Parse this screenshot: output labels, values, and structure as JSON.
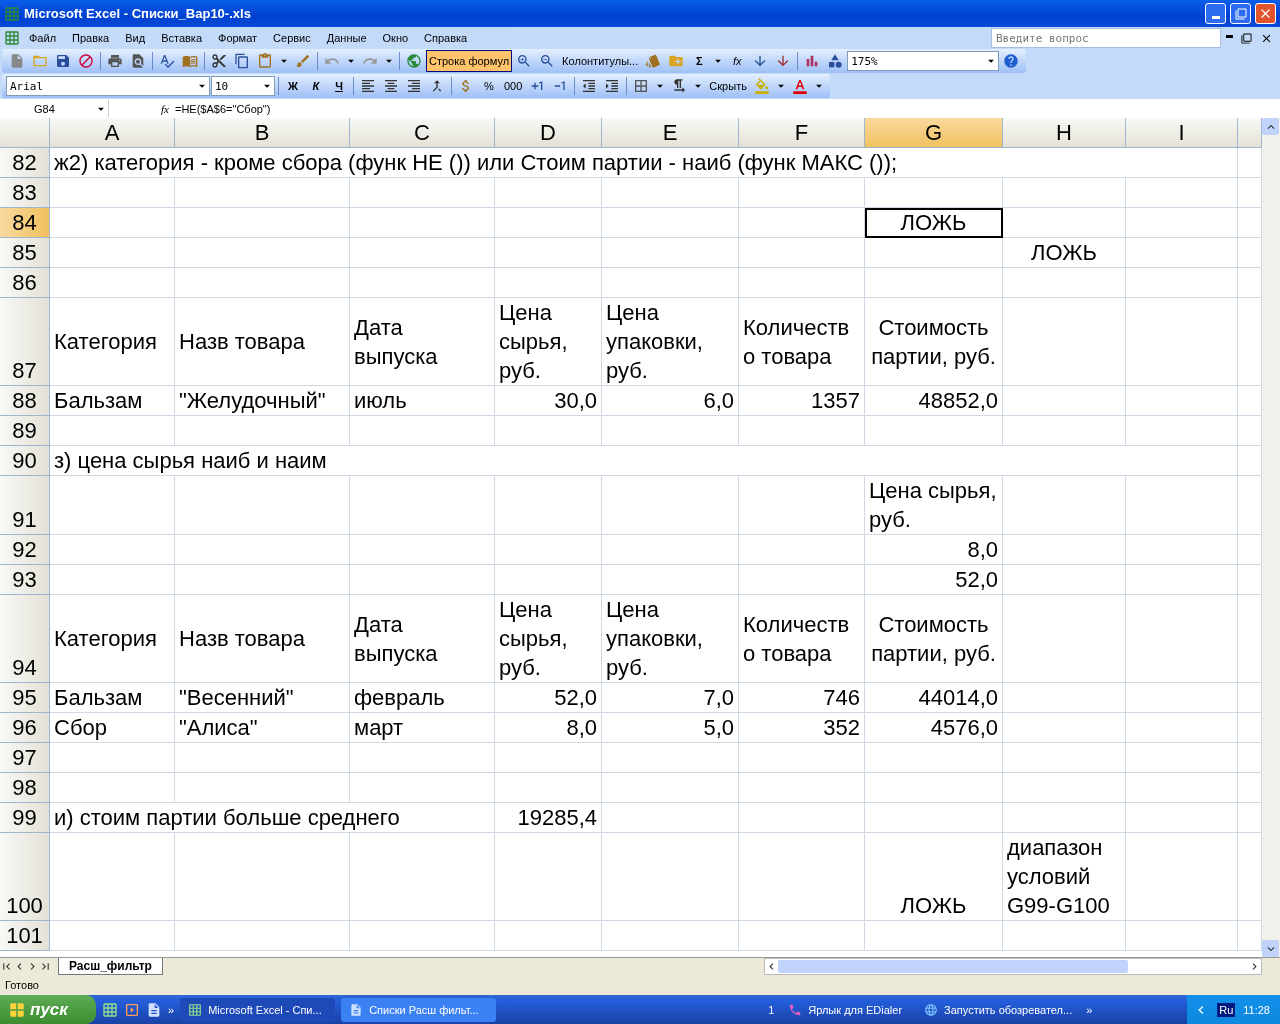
{
  "window": {
    "title": "Microsoft Excel - Списки_Вар10-.xls"
  },
  "menu": [
    {
      "label": "Файл"
    },
    {
      "label": "Правка"
    },
    {
      "label": "Вид"
    },
    {
      "label": "Вставка"
    },
    {
      "label": "Формат"
    },
    {
      "label": "Сервис"
    },
    {
      "label": "Данные"
    },
    {
      "label": "Окно"
    },
    {
      "label": "Справка"
    }
  ],
  "help_search": {
    "placeholder": "Введите вопрос"
  },
  "standard_toolbar": {
    "formula_bar_button": {
      "label": "Строка формул",
      "selected": true
    },
    "header_footer_button": {
      "label": "Колонтитулы..."
    },
    "sum_button": "Σ",
    "function_button": "fx",
    "zoom": "175%"
  },
  "formatting_toolbar": {
    "font": "Arial",
    "size": "10",
    "bold": "Ж",
    "italic": "К",
    "underline": "Ч",
    "percent": "%",
    "thousands": "000",
    "hide_button": "Скрыть"
  },
  "formula_bar": {
    "name_box": "G84",
    "fx": "fx",
    "formula": "=НЕ($A$6=\"Сбор\")"
  },
  "columns": [
    {
      "label": "A",
      "selected": false
    },
    {
      "label": "B",
      "selected": false
    },
    {
      "label": "C",
      "selected": false
    },
    {
      "label": "D",
      "selected": false
    },
    {
      "label": "E",
      "selected": false
    },
    {
      "label": "F",
      "selected": false
    },
    {
      "label": "G",
      "selected": true
    },
    {
      "label": "H",
      "selected": false
    },
    {
      "label": "I",
      "selected": false
    }
  ],
  "rows": [
    {
      "number": "82",
      "selected": false,
      "cells": [
        {
          "kind": "text",
          "text": "ж2) категория - кроме сбора (функ НЕ ()) или Стоим партии - наиб (функ МАКС ());",
          "selected": false
        },
        null,
        null,
        null,
        null,
        null,
        null,
        null,
        null
      ]
    },
    {
      "number": "83",
      "selected": false
    },
    {
      "number": "84",
      "selected": true,
      "cells": [
        null,
        null,
        null,
        null,
        null,
        null,
        {
          "kind": "centered",
          "text": "ЛОЖЬ",
          "selected": true
        },
        null,
        null
      ]
    },
    {
      "number": "85",
      "selected": false,
      "cells": [
        null,
        null,
        null,
        null,
        null,
        null,
        null,
        {
          "kind": "centered",
          "text": "ЛОЖЬ",
          "selected": false
        },
        null
      ]
    },
    {
      "number": "86",
      "selected": false
    },
    {
      "number": "87",
      "selected": false,
      "cells": [
        {
          "kind": "wrapped",
          "text": "Категория",
          "selected": false
        },
        {
          "kind": "wrapped",
          "text": "Назв товара",
          "selected": false
        },
        {
          "kind": "wrapped",
          "text": "Дата выпуска",
          "selected": false
        },
        {
          "kind": "wrapped",
          "text": "Цена сырья, руб.",
          "selected": false
        },
        {
          "kind": "wrapped",
          "text": "Цена упаковки, руб.",
          "selected": false
        },
        {
          "kind": "wrapped",
          "text": "Количество товара",
          "selected": false
        },
        {
          "kind": "centered-wrapped",
          "text": "Стоимость партии, руб.",
          "selected": false
        },
        null,
        null
      ]
    },
    {
      "number": "88",
      "selected": false,
      "cells": [
        {
          "kind": "text",
          "text": "Бальзам",
          "selected": false
        },
        {
          "kind": "text",
          "text": "\"Желудочный\"",
          "selected": false
        },
        {
          "kind": "text",
          "text": "июль",
          "selected": false
        },
        {
          "kind": "number",
          "text": "30,0",
          "selected": false
        },
        {
          "kind": "number",
          "text": "6,0",
          "selected": false
        },
        {
          "kind": "number",
          "text": "1357",
          "selected": false
        },
        {
          "kind": "number",
          "text": "48852,0",
          "selected": false
        },
        null,
        null
      ]
    },
    {
      "number": "89",
      "selected": false
    },
    {
      "number": "90",
      "selected": false,
      "cells": [
        {
          "kind": "text",
          "text": "з) цена сырья наиб и наим",
          "selected": false
        },
        null,
        null,
        null,
        null,
        null,
        null,
        null,
        null
      ]
    },
    {
      "number": "91",
      "selected": false,
      "cells": [
        null,
        null,
        null,
        null,
        null,
        null,
        {
          "kind": "wrapped",
          "text": "Цена сырья, руб.",
          "selected": false
        },
        null,
        null
      ]
    },
    {
      "number": "92",
      "selected": false,
      "cells": [
        null,
        null,
        null,
        null,
        null,
        null,
        {
          "kind": "number",
          "text": "8,0",
          "selected": false
        },
        null,
        null
      ]
    },
    {
      "number": "93",
      "selected": false,
      "cells": [
        null,
        null,
        null,
        null,
        null,
        null,
        {
          "kind": "number",
          "text": "52,0",
          "selected": false
        },
        null,
        null
      ]
    },
    {
      "number": "94",
      "selected": false,
      "cells": [
        {
          "kind": "wrapped",
          "text": "Категория",
          "selected": false
        },
        {
          "kind": "wrapped",
          "text": "Назв товара",
          "selected": false
        },
        {
          "kind": "wrapped",
          "text": "Дата выпуска",
          "selected": false
        },
        {
          "kind": "wrapped",
          "text": "Цена сырья, руб.",
          "selected": false
        },
        {
          "kind": "wrapped",
          "text": "Цена упаковки, руб.",
          "selected": false
        },
        {
          "kind": "wrapped",
          "text": "Количество товара",
          "selected": false
        },
        {
          "kind": "centered-wrapped",
          "text": "Стоимость партии, руб.",
          "selected": false
        },
        null,
        null
      ]
    },
    {
      "number": "95",
      "selected": false,
      "cells": [
        {
          "kind": "text",
          "text": "Бальзам",
          "selected": false
        },
        {
          "kind": "text",
          "text": "\"Весенний\"",
          "selected": false
        },
        {
          "kind": "text",
          "text": "февраль",
          "selected": false
        },
        {
          "kind": "number",
          "text": "52,0",
          "selected": false
        },
        {
          "kind": "number",
          "text": "7,0",
          "selected": false
        },
        {
          "kind": "number",
          "text": "746",
          "selected": false
        },
        {
          "kind": "number",
          "text": "44014,0",
          "selected": false
        },
        null,
        null
      ]
    },
    {
      "number": "96",
      "selected": false,
      "cells": [
        {
          "kind": "text",
          "text": "Сбор",
          "selected": false
        },
        {
          "kind": "text",
          "text": "\"Алиса\"",
          "selected": false
        },
        {
          "kind": "text",
          "text": "март",
          "selected": false
        },
        {
          "kind": "number",
          "text": "8,0",
          "selected": false
        },
        {
          "kind": "number",
          "text": "5,0",
          "selected": false
        },
        {
          "kind": "number",
          "text": "352",
          "selected": false
        },
        {
          "kind": "number",
          "text": "4576,0",
          "selected": false
        },
        null,
        null
      ]
    },
    {
      "number": "97",
      "selected": false
    },
    {
      "number": "98",
      "selected": false
    },
    {
      "number": "99",
      "selected": false,
      "cells": [
        {
          "kind": "text",
          "text": "и) стоим  партии больше среднего",
          "selected": false
        },
        null,
        null,
        {
          "kind": "number",
          "text": "19285,4",
          "selected": false
        },
        null,
        null,
        null,
        null,
        null
      ]
    },
    {
      "number": "100",
      "selected": false,
      "cells": [
        null,
        null,
        null,
        null,
        null,
        null,
        {
          "kind": "centered",
          "text": "ЛОЖЬ",
          "selected": false
        },
        {
          "kind": "wrapped",
          "text": "диапазон условий G99-G100",
          "selected": false
        },
        null
      ]
    },
    {
      "number": "101",
      "selected": false
    }
  ],
  "sheet_tabs": [
    {
      "label": "Расш_фильтр",
      "selected": true
    }
  ],
  "status_bar": {
    "text": "Готово"
  },
  "taskbar": {
    "start": "пуск",
    "more": "»",
    "tasks": [
      {
        "label": "Microsoft Excel - Спи...",
        "selected": true
      },
      {
        "label": "Списки Расш фильт...",
        "selected": false
      }
    ],
    "toolbar_number": "1",
    "shortcuts": [
      {
        "label": "Ярлык для EDialer"
      },
      {
        "label": "Запустить обозревател..."
      }
    ],
    "tray_more": "»",
    "language": "Ru",
    "clock": "11:28"
  }
}
